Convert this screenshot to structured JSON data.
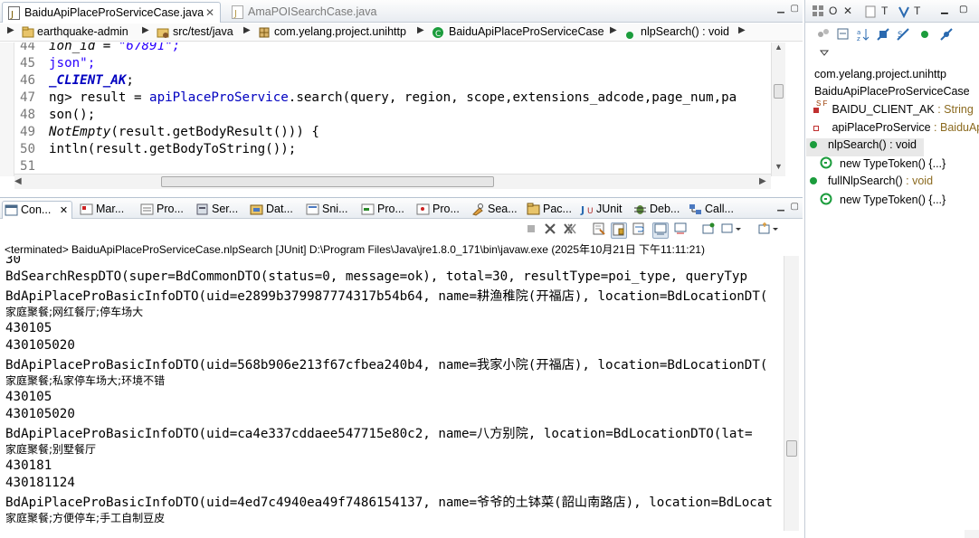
{
  "editor": {
    "tabs": [
      {
        "label": "BaiduApiPlaceProServiceCase.java",
        "active": true
      },
      {
        "label": "AmaPOISearchCase.java",
        "active": false
      }
    ],
    "breadcrumb": [
      {
        "label": "earthquake-admin"
      },
      {
        "label": "src/test/java"
      },
      {
        "label": "com.yelang.project.unihttp"
      },
      {
        "label": "BaiduApiPlaceProServiceCase"
      },
      {
        "label": "nlpSearch() : void"
      }
    ],
    "code": {
      "l44": {
        "num": "44",
        "a": "ion_id = ",
        "b": "\"67891\";"
      },
      "l45": {
        "num": "45",
        "a": "json\";"
      },
      "l46": {
        "num": "46",
        "a": "_CLIENT_AK",
        "b": ";"
      },
      "l47": {
        "num": "47",
        "a": "ng> result = ",
        "b": "apiPlaceProService",
        "c": ".search(query, region, scope,extensions_adcode,page_num,pa"
      },
      "l48": {
        "num": "48",
        "a": "son();"
      },
      "l49": {
        "num": "49",
        "a": "NotEmpty",
        "b": "(result.getBodyResult())) {"
      },
      "l50": {
        "num": "50",
        "a": "intln(result.getBodyToString());"
      },
      "l51": {
        "num": "51",
        "a": ""
      }
    }
  },
  "views": {
    "tabs": [
      "Con...",
      "Mar...",
      "Pro...",
      "Ser...",
      "Dat...",
      "Sni...",
      "Pro...",
      "Pro...",
      "Sea...",
      "Pac...",
      "JUnit",
      "Deb...",
      "Call..."
    ]
  },
  "console": {
    "status": "<terminated> BaiduApiPlaceProServiceCase.nlpSearch [JUnit] D:\\Program Files\\Java\\jre1.8.0_171\\bin\\javaw.exe (2025年10月21日 下午11:11:21)",
    "lines": [
      {
        "text": "30",
        "kind": "latin"
      },
      {
        "text": "BdSearchRespDTO(super=BdCommonDTO(status=0, message=ok), total=30, resultType=poi_type, queryTyp",
        "kind": "latin"
      },
      {
        "text": "BdApiPlaceProBasicInfoDTO(uid=e2899b379987774317b54b64, name=耕渔稚院(开福店), location=BdLocationDT(",
        "kind": "latin"
      },
      {
        "text": "家庭聚餐;网红餐厅;停车场大",
        "kind": "cjk"
      },
      {
        "text": "430105",
        "kind": "latin"
      },
      {
        "text": "430105020",
        "kind": "latin"
      },
      {
        "text": "BdApiPlaceProBasicInfoDTO(uid=568b906e213f67cfbea240b4, name=我家小院(开福店), location=BdLocationDT(",
        "kind": "latin"
      },
      {
        "text": "家庭聚餐;私家停车场大;环境不错",
        "kind": "cjk"
      },
      {
        "text": "430105",
        "kind": "latin"
      },
      {
        "text": "430105020",
        "kind": "latin"
      },
      {
        "text": "BdApiPlaceProBasicInfoDTO(uid=ca4e337cddaee547715e80c2, name=八方别院, location=BdLocationDTO(lat=",
        "kind": "latin"
      },
      {
        "text": "家庭聚餐;别墅餐厅",
        "kind": "cjk"
      },
      {
        "text": "430181",
        "kind": "latin"
      },
      {
        "text": "430181124",
        "kind": "latin"
      },
      {
        "text": "BdApiPlaceProBasicInfoDTO(uid=4ed7c4940ea49f7486154137, name=爷爷的土钵菜(韶山南路店), location=BdLocat",
        "kind": "latin"
      },
      {
        "text": "家庭聚餐;方便停车;手工自制豆皮",
        "kind": "cjk"
      }
    ]
  },
  "outline": {
    "tabs": [
      "O",
      "T",
      "T"
    ],
    "package": "com.yelang.project.unihttp",
    "class_name": "BaiduApiPlaceProServiceCase",
    "members": {
      "field1": {
        "name": "BAIDU_CLIENT_AK",
        "type": " : String",
        "badge": "S F"
      },
      "field2": {
        "name": "apiPlaceProService",
        "type": " : BaiduAp"
      },
      "method1": {
        "name": "nlpSearch() : void"
      },
      "anon1": {
        "name": "new TypeToken() {...}"
      },
      "method2": {
        "name": "fullNlpSearch()",
        "type": " : void"
      },
      "anon2": {
        "name": "new TypeToken() {...}"
      }
    }
  },
  "colors": {
    "accent": "#1b9c3c",
    "keyword_field": "#0000c0",
    "string": "#2a00ff"
  }
}
